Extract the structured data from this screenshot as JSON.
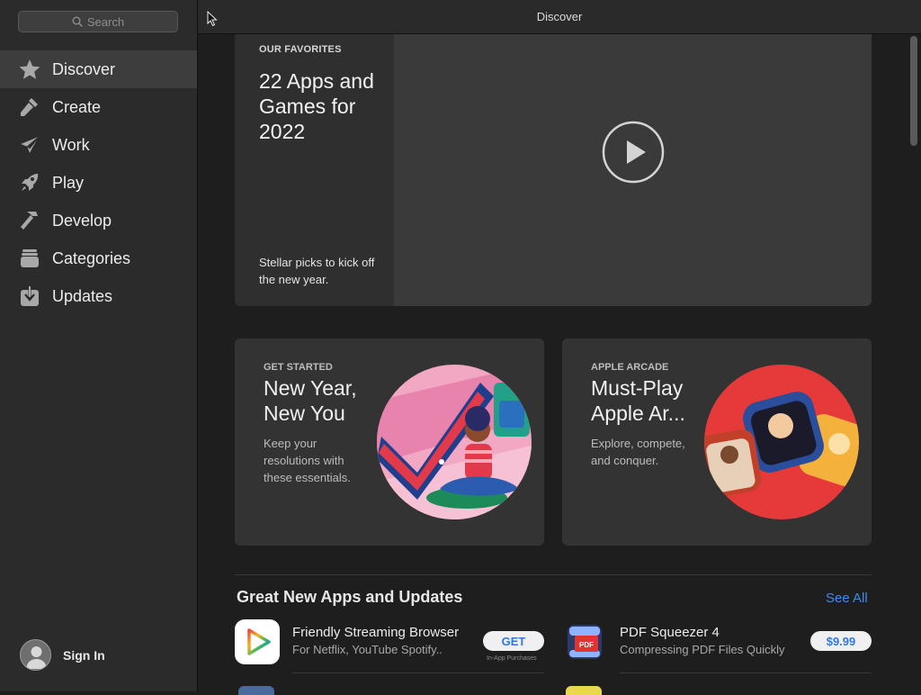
{
  "sidebar": {
    "search_placeholder": "Search",
    "items": [
      {
        "label": "Discover",
        "icon": "star-icon",
        "active": true
      },
      {
        "label": "Create",
        "icon": "brush-icon",
        "active": false
      },
      {
        "label": "Work",
        "icon": "paper-plane-icon",
        "active": false
      },
      {
        "label": "Play",
        "icon": "rocket-icon",
        "active": false
      },
      {
        "label": "Develop",
        "icon": "hammer-icon",
        "active": false
      },
      {
        "label": "Categories",
        "icon": "stack-icon",
        "active": false
      },
      {
        "label": "Updates",
        "icon": "download-icon",
        "active": false
      }
    ],
    "sign_in": "Sign In"
  },
  "topbar": {
    "title": "Discover"
  },
  "hero": {
    "eyebrow": "OUR FAVORITES",
    "headline": "22 Apps and Games for 2022",
    "subtitle": "Stellar picks to kick off the new year."
  },
  "cards": [
    {
      "eyebrow": "GET STARTED",
      "headline": "New Year, New You",
      "subtitle": "Keep your resolutions with these essentials."
    },
    {
      "eyebrow": "APPLE ARCADE",
      "headline": "Must-Play Apple Ar...",
      "subtitle": "Explore, compete, and conquer."
    }
  ],
  "section": {
    "title": "Great New Apps and Updates",
    "see_all": "See All"
  },
  "apps": [
    {
      "name": "Friendly Streaming Browser",
      "desc": "For Netflix, YouTube Spotify..",
      "button": "GET",
      "note": "In-App Purchases"
    },
    {
      "name": "PDF Squeezer 4",
      "desc": "Compressing PDF Files Quickly",
      "button": "$9.99"
    }
  ],
  "colors": {
    "accent": "#3b8cf0",
    "sidebar_bg": "#2b2b2b",
    "main_bg": "#1e1e1e",
    "card_bg": "#333333"
  }
}
